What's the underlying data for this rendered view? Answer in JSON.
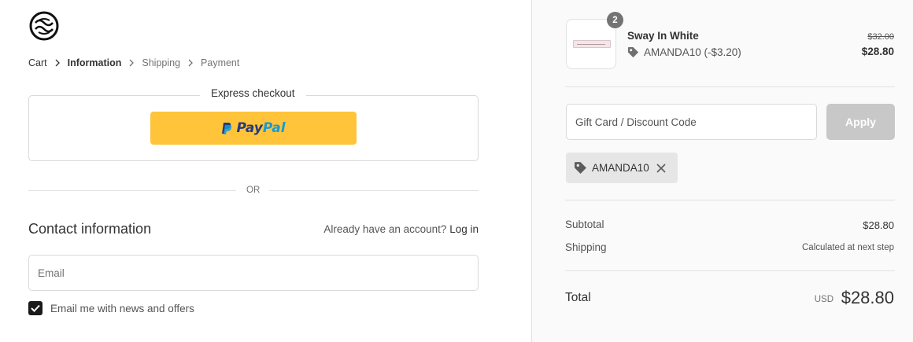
{
  "breadcrumb": {
    "items": [
      "Cart",
      "Information",
      "Shipping",
      "Payment"
    ]
  },
  "express": {
    "title": "Express checkout",
    "paypal_pay": "Pay",
    "paypal_pal": "Pal"
  },
  "or_text": "OR",
  "contact": {
    "title": "Contact information",
    "account_prompt": "Already have an account?",
    "login_link": "Log in",
    "email_placeholder": "Email",
    "newsletter_label": "Email me with news and offers",
    "newsletter_checked": true
  },
  "order": {
    "quantity": "2",
    "product_name": "Sway In White",
    "discount_line": "AMANDA10 (-$3.20)",
    "price_original": "$32.00",
    "price_final": "$28.80"
  },
  "discount": {
    "placeholder": "Gift Card / Discount Code",
    "apply_label": "Apply",
    "applied_code": "AMANDA10"
  },
  "summary": {
    "subtotal_label": "Subtotal",
    "subtotal_value": "$28.80",
    "shipping_label": "Shipping",
    "shipping_value": "Calculated at next step",
    "total_label": "Total",
    "currency": "USD",
    "total_value": "$28.80"
  },
  "colors": {
    "paypal_yellow": "#ffc439",
    "paypal_dark_blue": "#253b80",
    "paypal_light_blue": "#179bd7",
    "sidebar_bg": "#fafafa",
    "apply_disabled": "#c8c8c8",
    "chip_bg": "#e6e6e6"
  }
}
